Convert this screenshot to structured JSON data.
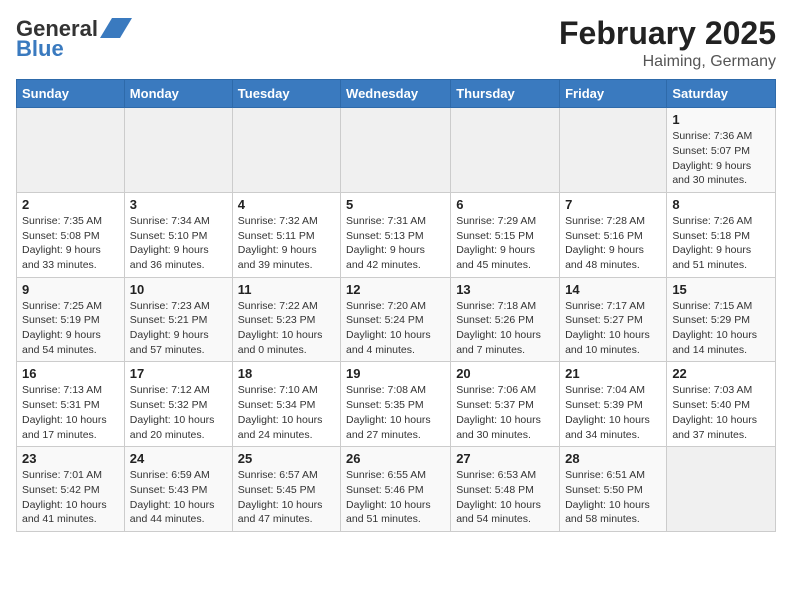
{
  "header": {
    "logo_general": "General",
    "logo_blue": "Blue",
    "month": "February 2025",
    "location": "Haiming, Germany"
  },
  "weekdays": [
    "Sunday",
    "Monday",
    "Tuesday",
    "Wednesday",
    "Thursday",
    "Friday",
    "Saturday"
  ],
  "weeks": [
    [
      {
        "day": "",
        "info": ""
      },
      {
        "day": "",
        "info": ""
      },
      {
        "day": "",
        "info": ""
      },
      {
        "day": "",
        "info": ""
      },
      {
        "day": "",
        "info": ""
      },
      {
        "day": "",
        "info": ""
      },
      {
        "day": "1",
        "info": "Sunrise: 7:36 AM\nSunset: 5:07 PM\nDaylight: 9 hours and 30 minutes."
      }
    ],
    [
      {
        "day": "2",
        "info": "Sunrise: 7:35 AM\nSunset: 5:08 PM\nDaylight: 9 hours and 33 minutes."
      },
      {
        "day": "3",
        "info": "Sunrise: 7:34 AM\nSunset: 5:10 PM\nDaylight: 9 hours and 36 minutes."
      },
      {
        "day": "4",
        "info": "Sunrise: 7:32 AM\nSunset: 5:11 PM\nDaylight: 9 hours and 39 minutes."
      },
      {
        "day": "5",
        "info": "Sunrise: 7:31 AM\nSunset: 5:13 PM\nDaylight: 9 hours and 42 minutes."
      },
      {
        "day": "6",
        "info": "Sunrise: 7:29 AM\nSunset: 5:15 PM\nDaylight: 9 hours and 45 minutes."
      },
      {
        "day": "7",
        "info": "Sunrise: 7:28 AM\nSunset: 5:16 PM\nDaylight: 9 hours and 48 minutes."
      },
      {
        "day": "8",
        "info": "Sunrise: 7:26 AM\nSunset: 5:18 PM\nDaylight: 9 hours and 51 minutes."
      }
    ],
    [
      {
        "day": "9",
        "info": "Sunrise: 7:25 AM\nSunset: 5:19 PM\nDaylight: 9 hours and 54 minutes."
      },
      {
        "day": "10",
        "info": "Sunrise: 7:23 AM\nSunset: 5:21 PM\nDaylight: 9 hours and 57 minutes."
      },
      {
        "day": "11",
        "info": "Sunrise: 7:22 AM\nSunset: 5:23 PM\nDaylight: 10 hours and 0 minutes."
      },
      {
        "day": "12",
        "info": "Sunrise: 7:20 AM\nSunset: 5:24 PM\nDaylight: 10 hours and 4 minutes."
      },
      {
        "day": "13",
        "info": "Sunrise: 7:18 AM\nSunset: 5:26 PM\nDaylight: 10 hours and 7 minutes."
      },
      {
        "day": "14",
        "info": "Sunrise: 7:17 AM\nSunset: 5:27 PM\nDaylight: 10 hours and 10 minutes."
      },
      {
        "day": "15",
        "info": "Sunrise: 7:15 AM\nSunset: 5:29 PM\nDaylight: 10 hours and 14 minutes."
      }
    ],
    [
      {
        "day": "16",
        "info": "Sunrise: 7:13 AM\nSunset: 5:31 PM\nDaylight: 10 hours and 17 minutes."
      },
      {
        "day": "17",
        "info": "Sunrise: 7:12 AM\nSunset: 5:32 PM\nDaylight: 10 hours and 20 minutes."
      },
      {
        "day": "18",
        "info": "Sunrise: 7:10 AM\nSunset: 5:34 PM\nDaylight: 10 hours and 24 minutes."
      },
      {
        "day": "19",
        "info": "Sunrise: 7:08 AM\nSunset: 5:35 PM\nDaylight: 10 hours and 27 minutes."
      },
      {
        "day": "20",
        "info": "Sunrise: 7:06 AM\nSunset: 5:37 PM\nDaylight: 10 hours and 30 minutes."
      },
      {
        "day": "21",
        "info": "Sunrise: 7:04 AM\nSunset: 5:39 PM\nDaylight: 10 hours and 34 minutes."
      },
      {
        "day": "22",
        "info": "Sunrise: 7:03 AM\nSunset: 5:40 PM\nDaylight: 10 hours and 37 minutes."
      }
    ],
    [
      {
        "day": "23",
        "info": "Sunrise: 7:01 AM\nSunset: 5:42 PM\nDaylight: 10 hours and 41 minutes."
      },
      {
        "day": "24",
        "info": "Sunrise: 6:59 AM\nSunset: 5:43 PM\nDaylight: 10 hours and 44 minutes."
      },
      {
        "day": "25",
        "info": "Sunrise: 6:57 AM\nSunset: 5:45 PM\nDaylight: 10 hours and 47 minutes."
      },
      {
        "day": "26",
        "info": "Sunrise: 6:55 AM\nSunset: 5:46 PM\nDaylight: 10 hours and 51 minutes."
      },
      {
        "day": "27",
        "info": "Sunrise: 6:53 AM\nSunset: 5:48 PM\nDaylight: 10 hours and 54 minutes."
      },
      {
        "day": "28",
        "info": "Sunrise: 6:51 AM\nSunset: 5:50 PM\nDaylight: 10 hours and 58 minutes."
      },
      {
        "day": "",
        "info": ""
      }
    ]
  ]
}
